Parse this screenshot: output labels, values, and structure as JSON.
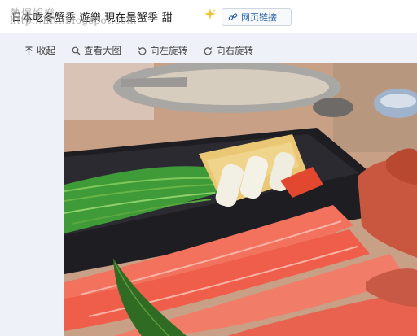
{
  "header": {
    "title": "日本吃冬蟹季 遊樂 現在是蟹季 甜",
    "link_button_label": "网页链接",
    "watermark_line1": "熱爆娛樂",
    "watermark_line2": "http://hitt.blogspot.com"
  },
  "toolbar": {
    "collapse_label": "收起",
    "view_large_label": "查看大图",
    "rotate_left_label": "向左旋转",
    "rotate_right_label": "向右旋转"
  },
  "colors": {
    "accent": "#2a62a6",
    "viewer_bg": "#eef2f8"
  },
  "icons": [
    "sparkle-icon",
    "link-icon",
    "collapse-arrow-icon",
    "magnifier-icon",
    "rotate-left-icon",
    "rotate-right-icon"
  ]
}
